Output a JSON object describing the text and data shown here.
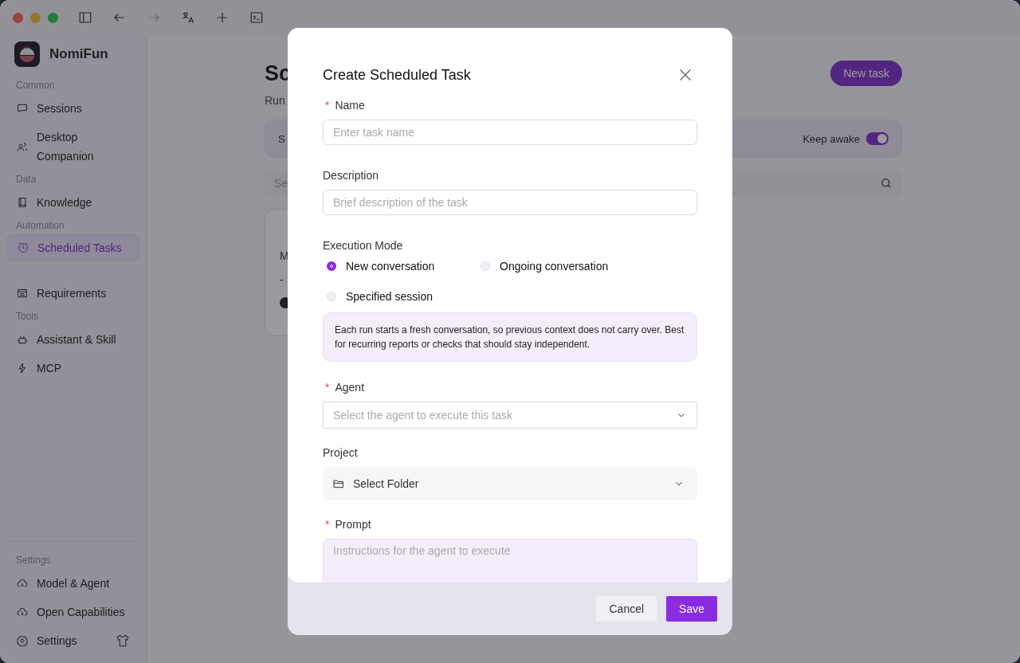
{
  "app": {
    "name": "NomiFun"
  },
  "sidebar": {
    "groups": [
      {
        "label": "Common",
        "items": [
          {
            "label": "Sessions",
            "selected": false
          },
          {
            "label": "Desktop\nCompanion",
            "selected": false
          }
        ]
      },
      {
        "label": "Data",
        "items": [
          {
            "label": "Knowledge",
            "selected": false
          }
        ]
      },
      {
        "label": "Automation",
        "items": [
          {
            "label": "Scheduled Tasks",
            "selected": true
          },
          {
            "label": "Requirements",
            "selected": false
          }
        ]
      },
      {
        "label": "Tools",
        "items": [
          {
            "label": "Assistant & Skill",
            "selected": false
          },
          {
            "label": "MCP",
            "selected": false
          }
        ]
      }
    ],
    "footer": {
      "label": "Settings",
      "items": [
        {
          "label": "Model & Agent",
          "selected": false
        },
        {
          "label": "Open Capabilities",
          "selected": false
        },
        {
          "label": "Settings",
          "selected": false
        }
      ]
    }
  },
  "page": {
    "title": "Sc",
    "subtitle": "Run",
    "new_button": "New task",
    "banner": {
      "label": "S",
      "keep_awake": {
        "label": "Keep awake",
        "on": true
      }
    },
    "search": {
      "placeholder": "Se"
    },
    "card": {
      "line_1": "M",
      "line_2": "-"
    }
  },
  "dialog": {
    "title": "Create Scheduled Task",
    "name": {
      "label": "Name",
      "required_mark": "*",
      "placeholder": "Enter task name"
    },
    "description": {
      "label": "Description",
      "placeholder": "Brief description of the task"
    },
    "execution_mode": {
      "label": "Execution Mode",
      "options": [
        {
          "label": "New conversation",
          "selected": true
        },
        {
          "label": "Ongoing conversation",
          "selected": false
        },
        {
          "label": "Specified session",
          "selected": false
        }
      ],
      "hint": "Each run starts a fresh conversation, so previous context does not carry over. Best for recurring reports or checks that should stay independent."
    },
    "agent": {
      "label": "Agent",
      "required_mark": "*",
      "placeholder": "Select the agent to execute this task"
    },
    "project": {
      "label": "Project",
      "value": "Select Folder"
    },
    "prompt": {
      "label": "Prompt",
      "required_mark": "*",
      "placeholder": "Instructions for the agent to execute"
    },
    "buttons": {
      "cancel": "Cancel",
      "save": "Save"
    }
  }
}
